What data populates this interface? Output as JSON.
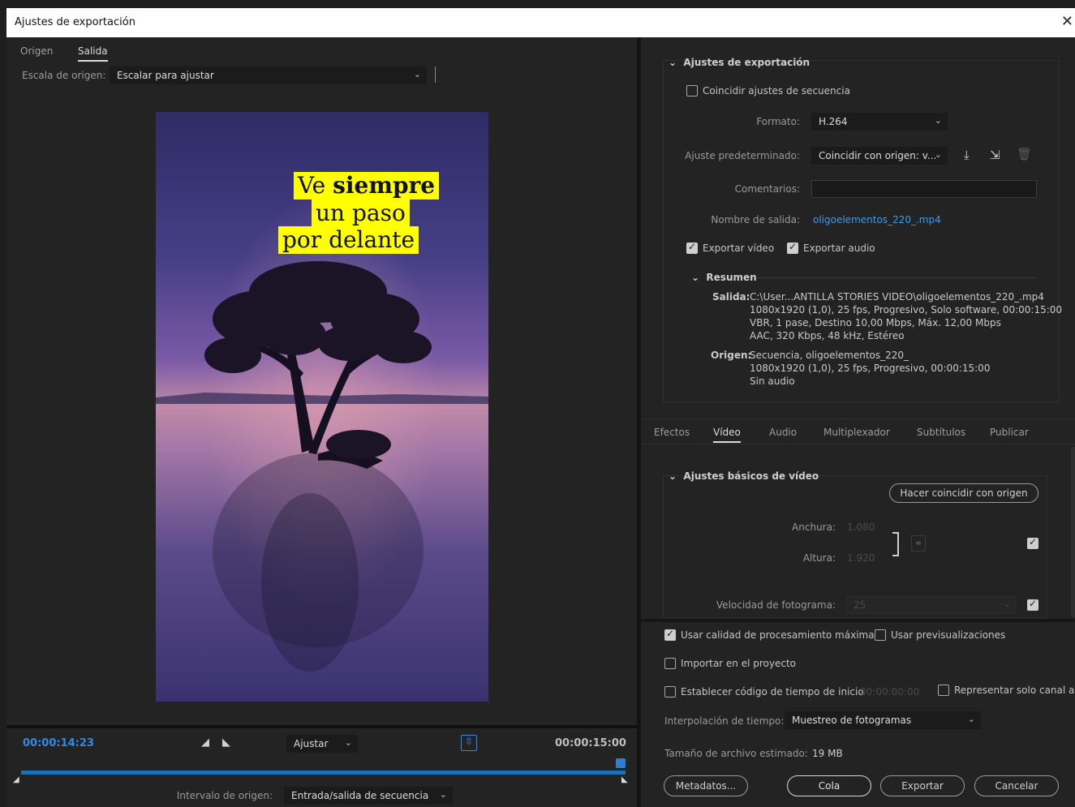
{
  "window": {
    "title": "Ajustes de exportación",
    "close_glyph": "✕"
  },
  "source_tabs": [
    {
      "label": "Origen"
    },
    {
      "label": "Salida",
      "active": true
    }
  ],
  "scale": {
    "label": "Escala de origen:",
    "value": "Escalar para ajustar"
  },
  "preview": {
    "caption_lines": [
      "Ve ",
      "siempre",
      "un paso",
      "por delante"
    ],
    "caption_bg": "#ffff00"
  },
  "timeline": {
    "current_tc": "00:00:14:23",
    "end_tc": "00:00:15:00",
    "zoom": "Ajustar",
    "range_label": "Intervalo de origen:",
    "range_value": "Entrada/salida de secuencia",
    "accent": "#2d8ceb"
  },
  "export": {
    "heading": "Ajustes de exportación",
    "match_seq": {
      "label": "Coincidir ajustes de secuencia",
      "checked": false
    },
    "format_label": "Formato:",
    "format_value": "H.264",
    "preset_label": "Ajuste predeterminado:",
    "preset_value": "Coincidir con origen: v...",
    "comments_label": "Comentarios:",
    "output_name_label": "Nombre de salida:",
    "output_name": "oligoelementos_220_.mp4",
    "export_video": "Exportar vídeo",
    "export_audio": "Exportar audio",
    "summary_heading": "Resumen",
    "output_key": "Salida:",
    "output_lines": [
      "C:\\User...ANTILLA STORIES VIDEO\\oligoelementos_220_.mp4",
      "1080x1920 (1,0), 25 fps, Progresivo, Solo software, 00:00:15:00",
      "VBR, 1 pase, Destino 10,00 Mbps, Máx. 12,00 Mbps",
      "AAC, 320 Kbps, 48 kHz, Estéreo"
    ],
    "source_key": "Origen:",
    "source_lines": [
      "Secuencia, oligoelementos_220_",
      "1080x1920 (1,0), 25 fps, Progresivo, 00:00:15:00",
      "Sin audio"
    ]
  },
  "subtabs": [
    {
      "label": "Efectos"
    },
    {
      "label": "Vídeo",
      "active": true
    },
    {
      "label": "Audio"
    },
    {
      "label": "Multiplexador"
    },
    {
      "label": "Subtítulos"
    },
    {
      "label": "Publicar"
    }
  ],
  "video_basic": {
    "heading": "Ajustes básicos de vídeo",
    "match_button": "Hacer coincidir con origen",
    "width_label": "Anchura:",
    "width_value": "1.080",
    "height_label": "Altura:",
    "height_value": "1.920",
    "fps_label": "Velocidad de fotograma:",
    "fps_value": "25"
  },
  "bottom": {
    "max_quality": "Usar calidad de procesamiento máxima",
    "use_previews": "Usar previsualizaciones",
    "import_project": "Importar en el proyecto",
    "start_tc": "Establecer código de tiempo de inicio",
    "start_tc_value": "00:00:00:00",
    "alpha_only": "Representar solo canal alfa",
    "interp_label": "Interpolación de tiempo:",
    "interp_value": "Muestreo de fotogramas",
    "size_label": "Tamaño de archivo estimado:",
    "size_value": "19 MB",
    "btn_metadata": "Metadatos...",
    "btn_queue": "Cola",
    "btn_export": "Exportar",
    "btn_cancel": "Cancelar"
  }
}
